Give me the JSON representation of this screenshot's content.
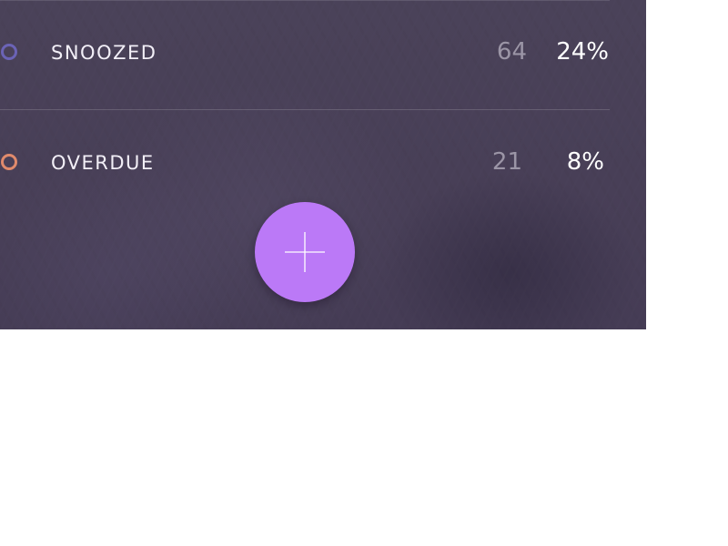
{
  "rows": [
    {
      "label": "SNOOZED",
      "count": "64",
      "percent": "24%",
      "dot_color": "#6b63b6"
    },
    {
      "label": "OVERDUE",
      "count": "21",
      "percent": "8%",
      "dot_color": "#e08a6c"
    }
  ],
  "fab": {
    "icon": "plus-icon",
    "color": "#bb79f7"
  },
  "colors": {
    "panel_background": "#4a4259",
    "count_text": "#9b95a6",
    "percent_text": "#ffffff"
  }
}
